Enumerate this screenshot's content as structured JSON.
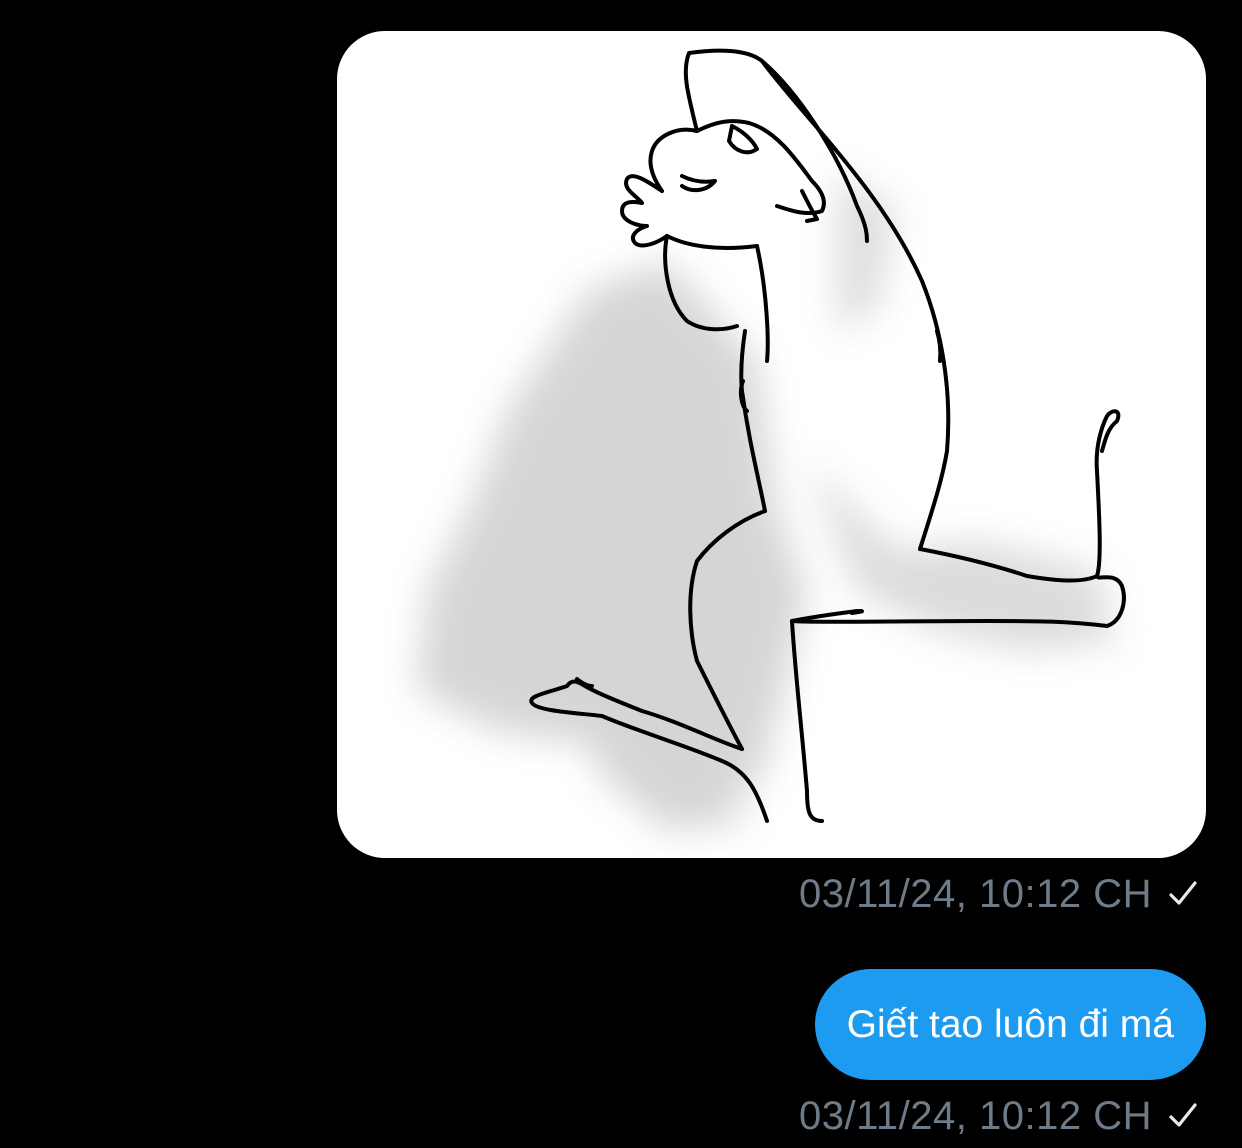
{
  "messages": [
    {
      "kind": "image",
      "image_name": "line-drawing-running-figure",
      "timestamp": "03/11/24, 10:12 CH",
      "status_icon": "checkmark-icon"
    },
    {
      "kind": "text",
      "text": "Giết tao luôn đi má",
      "timestamp": "03/11/24, 10:12 CH",
      "status_icon": "checkmark-icon"
    }
  ],
  "colors": {
    "background": "#000000",
    "sent_bubble": "#1d9bf0",
    "bubble_text": "#ffffff",
    "timestamp": "#6e7b89",
    "image_background": "#ffffff"
  }
}
